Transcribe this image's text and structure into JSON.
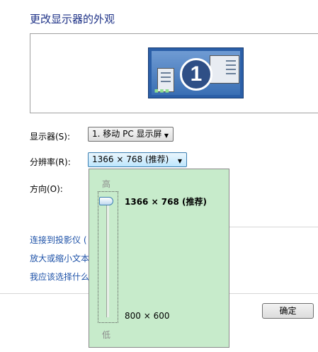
{
  "title": "更改显示器的外观",
  "preview": {
    "monitor_number": "1"
  },
  "fields": {
    "display_label": "显示器(S):",
    "display_value": "1. 移动 PC 显示屏",
    "resolution_label": "分辨率(R):",
    "resolution_value": "1366 × 768 (推荐)",
    "orientation_label": "方向(O):"
  },
  "popup": {
    "high_label": "高",
    "low_label": "低",
    "max_resolution": "1366 × 768 (推荐)",
    "min_resolution": "800 × 600",
    "slider_level": 1.0
  },
  "links": {
    "projector": "连接到投影仪 (",
    "text_size": "放大或缩小文本",
    "help": "我应该选择什么"
  },
  "buttons": {
    "ok": "确定"
  }
}
